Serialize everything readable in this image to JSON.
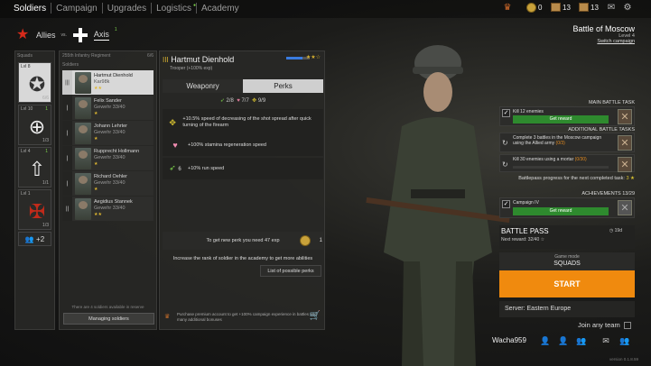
{
  "nav": {
    "tabs": [
      {
        "label": "Soldiers",
        "active": true
      },
      {
        "label": "Campaign",
        "active": false
      },
      {
        "label": "Upgrades",
        "active": false
      },
      {
        "label": "Logistics",
        "active": false
      },
      {
        "label": "Academy",
        "active": false
      }
    ]
  },
  "resources": {
    "gold": "0",
    "cards1": "13",
    "cards2": "13"
  },
  "sides": {
    "allies": "Allies",
    "vs": "vs.",
    "axis": "Axis",
    "axis_count": "1"
  },
  "squads": {
    "header": "Squads",
    "items": [
      {
        "lvl": "Lvl 8",
        "count": "6/6",
        "selected": true
      },
      {
        "lvl": "Lvl 10",
        "count": "1/3",
        "badge": "1",
        "selected": false
      },
      {
        "lvl": "Lvl 4",
        "count": "1/1",
        "badge": "1",
        "selected": false
      },
      {
        "lvl": "Lvl 1",
        "count": "1/3",
        "selected": false
      }
    ],
    "add_label": "+2"
  },
  "soldiers": {
    "regiment": "255th Infantry Regiment",
    "count": "6/6",
    "header": "Soldiers",
    "items": [
      {
        "name": "Hartmut Dienhold",
        "weapon": "Kar98k",
        "stars": "★★",
        "selected": true
      },
      {
        "name": "Felix Sander",
        "weapon": "Gewehr 33/40",
        "stars": "★",
        "selected": false
      },
      {
        "name": "Johann Lehrter",
        "weapon": "Gewehr 33/40",
        "stars": "★",
        "selected": false
      },
      {
        "name": "Rupprecht Hollmann",
        "weapon": "Gewehr 33/40",
        "stars": "★",
        "selected": false
      },
      {
        "name": "Richard Oehler",
        "weapon": "Gewehr 33/40",
        "stars": "★",
        "selected": false
      },
      {
        "name": "Aegidius Stannek",
        "weapon": "Gewehr 33/40",
        "stars": "★★",
        "selected": false
      }
    ],
    "reserve_note": "There are 4 soldiers available in reserve",
    "manage_label": "Managing soldiers"
  },
  "details": {
    "rank": "III",
    "name": "Hartmut Dienhold",
    "sub": "Trooper  (+100% exp)",
    "stars": "★★☆",
    "tab_weaponry": "Weaponry",
    "tab_perks": "Perks",
    "points": {
      "green": "2/8",
      "pink": "7/7",
      "yellow": "9/9"
    },
    "perks": [
      {
        "text": "+10.5% speed of decreasing of the shot spread after quick turning of the firearm",
        "color": "yellow",
        "icon": "crosshair-icon"
      },
      {
        "text": "+100% stamina regeneration speed",
        "color": "pink",
        "icon": "heart-icon"
      },
      {
        "cost": "6",
        "text": "+10% run speed",
        "color": "green",
        "icon": "run-icon"
      }
    ],
    "new_perk": "To get new perk you need 47 exp",
    "coin_count": "1",
    "increase": "Increase the rank of soldier in the academy to get more abilities",
    "list_perks": "List of possible perks",
    "premium": "Purchase premium account to get +100% campaign experience in battles and many additional bonuses"
  },
  "battle": {
    "name": "Battle of Moscow",
    "level": "Level 4",
    "switch": "Switch campaign"
  },
  "tasks": {
    "main_header": "MAIN BATTLE TASK",
    "main": {
      "text": "Kill 12 enemies",
      "reward": "Get reward"
    },
    "add_header": "ADDITIONAL BATTLE TASKS",
    "add": [
      {
        "text": "Complete 3 battles in the Moscow campaign using the Allied army",
        "progress": "(0/3)"
      },
      {
        "text": "Kill 30 enemies using a mortar",
        "progress": "(0/30)"
      }
    ],
    "bp_progress": "Battlepass progress for the next completed task:",
    "bp_progress_val": "3 ★"
  },
  "achievements": {
    "header": "ACHIEVEMENTS 13/29",
    "item": "Campaign IV",
    "reward": "Get reward"
  },
  "battlepass": {
    "title": "BATTLE PASS",
    "next": "Next reward: 32/40 ☆",
    "days": "◷ 19d"
  },
  "mode": {
    "label": "Game mode",
    "value": "SQUADS"
  },
  "start": "START",
  "server": "Server: Eastern Europe",
  "join": "Join any team",
  "username": "Wacha959",
  "version": "version 0.1.8.59"
}
